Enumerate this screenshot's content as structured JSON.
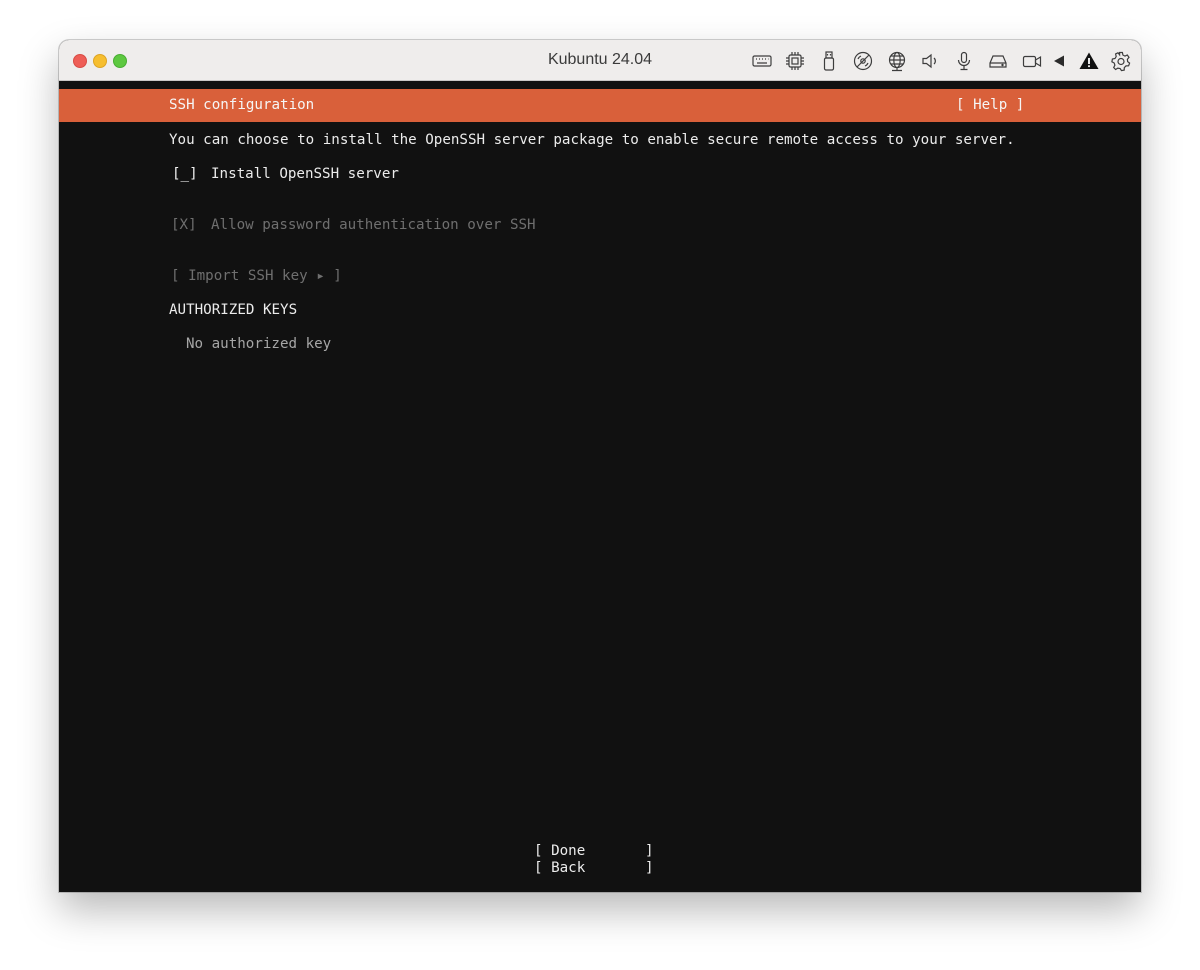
{
  "window": {
    "title": "Kubuntu 24.04"
  },
  "toolbar": {
    "icons": [
      "keyboard-icon",
      "cpu-icon",
      "usb-icon",
      "disc-icon",
      "network-icon",
      "speaker-icon",
      "microphone-icon",
      "drive-icon",
      "camera-icon",
      "back-triangle-icon",
      "warning-icon",
      "gear-icon"
    ]
  },
  "colors": {
    "header_accent": "#d9603a",
    "terminal_bg": "#111111",
    "text": "#ececec",
    "dim_text": "#6f6f6f"
  },
  "installer": {
    "title": "SSH configuration",
    "help": "[ Help ]",
    "description": "You can choose to install the OpenSSH server package to enable secure remote access to your server.",
    "install_checkbox": {
      "mark": "[_]",
      "label": "Install OpenSSH server",
      "checked": false
    },
    "password_checkbox": {
      "mark": "[X]",
      "label": "Allow password authentication over SSH",
      "checked": true,
      "disabled": true
    },
    "import_button": "[ Import SSH key ▸ ]",
    "authorized_keys_heading": "AUTHORIZED KEYS",
    "authorized_keys_empty": "No authorized key",
    "done_button": "[ Done       ]",
    "back_button": "[ Back       ]"
  }
}
